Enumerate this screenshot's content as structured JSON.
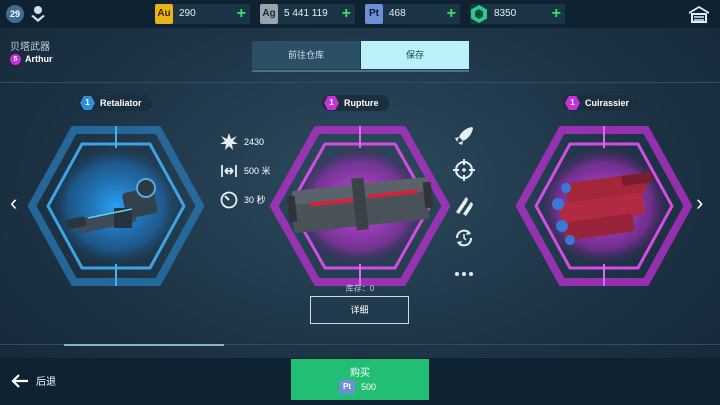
{
  "player": {
    "level": "29"
  },
  "currencies": [
    {
      "code": "Au",
      "value": "290",
      "color": "#e8b21a"
    },
    {
      "code": "Ag",
      "value": "5 441 119",
      "color": "#9aa4ad"
    },
    {
      "code": "Pt",
      "value": "468",
      "color": "#6e8fd6"
    },
    {
      "code": "key",
      "value": "8350",
      "color": "#2ec98d"
    }
  ],
  "header": {
    "title": "贝塔武器",
    "owner": {
      "level": "5",
      "name": "Arthur"
    }
  },
  "tabs": [
    {
      "label": "前往仓库",
      "active": false
    },
    {
      "label": "保存",
      "active": true
    }
  ],
  "weapons": [
    {
      "level": "1",
      "name": "Retaliator",
      "color": "#2f8fd8"
    },
    {
      "level": "1",
      "name": "Rupture",
      "color": "#c533d6"
    },
    {
      "level": "1",
      "name": "Cuirassier",
      "color": "#c533d6"
    }
  ],
  "stats": {
    "damage": "2430",
    "range": "500 米",
    "reload": "30 秒"
  },
  "side_icons": [
    "rocket-icon",
    "crosshair-icon",
    "ammo-icon",
    "reload-cycle-icon",
    "more-icon"
  ],
  "stock": "库存：0",
  "detail_label": "详细",
  "back_label": "后退",
  "buy": {
    "label": "购买",
    "currency": "Pt",
    "price": "500"
  }
}
